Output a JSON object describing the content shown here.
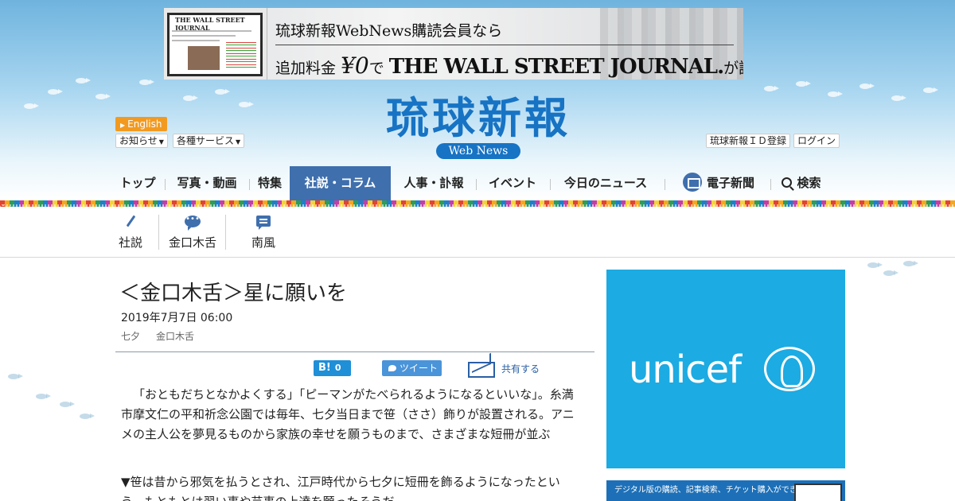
{
  "banner_ad": {
    "line1": "琉球新報WebNews購読会員なら",
    "line2_prefix": "追加料金",
    "line2_price": "¥0",
    "line2_de": "で",
    "line2_brand": "THE WALL STREET JOURNAL.",
    "line2_suffix": "が読める",
    "mini_brand": "THE WALL STREET JOURNAL"
  },
  "header": {
    "english_label": "English",
    "notice_label": "お知らせ",
    "services_label": "各種サービス",
    "id_register_label": "琉球新報ＩＤ登録",
    "login_label": "ログイン"
  },
  "logo": {
    "name": "琉球新報",
    "sub": "Web News"
  },
  "nav": {
    "items": [
      "トップ",
      "写真・動画",
      "特集",
      "社説・コラム",
      "人事・訃報",
      "イベント",
      "今日のニュース",
      "電子新聞",
      "検索"
    ]
  },
  "subnav": {
    "items": [
      "社説",
      "金口木舌",
      "南風"
    ]
  },
  "article": {
    "title": "＜金口木舌＞星に願いを",
    "date": "2019年7月7日 06:00",
    "tags": [
      "七夕",
      "金口木舌"
    ],
    "hatena_count": "0",
    "tweet_label": "ツイート",
    "share_label": "共有する",
    "paragraphs": [
      "「おともだちとなかよくする」「ピーマンがたべられるようになるといいな」。糸満市摩文仁の平和祈念公園では毎年、七夕当日まで笹（ささ）飾りが設置される。アニメの主人公を夢見るものから家族の幸せを願うものまで、さまざまな短冊が並ぶ",
      "▼笹は昔から邪気を払うとされ、江戸時代から七夕に短冊を飾るようになったという。もともとは習い事や芸事の上達を願ったそうだ"
    ]
  },
  "ads": {
    "unicef_word": "unicef",
    "ad2_text": "デジタル版の購読、記事検索、チケット購入ができる"
  },
  "colors": {
    "brand_blue": "#1773c4",
    "nav_active": "#3f6fad",
    "english_orange": "#f29a20",
    "unicef_blue": "#1cabe2"
  }
}
